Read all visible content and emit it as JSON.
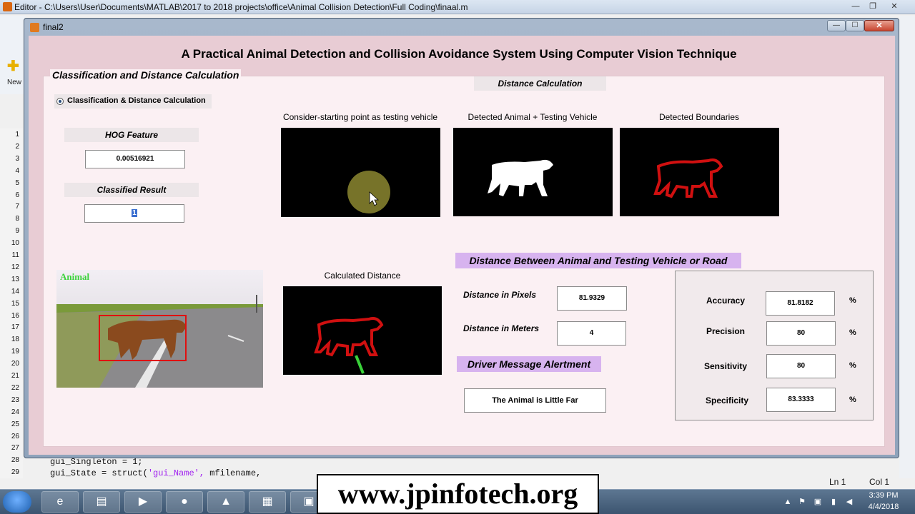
{
  "editor": {
    "title": "Editor - C:\\Users\\User\\Documents\\MATLAB\\2017 to 2018 projects\\office\\Animal Collision Detection\\Full Coding\\finaal.m",
    "new_label": "New",
    "line_numbers": [
      "1",
      "2",
      "3",
      "4",
      "5",
      "6",
      "7",
      "8",
      "9",
      "10",
      "11",
      "12",
      "13",
      "14",
      "15",
      "16",
      "17",
      "18",
      "19",
      "20",
      "21",
      "22",
      "23",
      "24",
      "25",
      "26",
      "27",
      "28",
      "29"
    ],
    "code_line_1": "gui_Singleton = 1;",
    "code_line_2_start": "gui_State = struct(",
    "code_line_2_string": "'gui_Name',",
    "code_line_2_end": "      mfilename,",
    "status_ln": "Ln  1",
    "status_col": "Col  1"
  },
  "taskbar": {
    "time": "3:39 PM",
    "date": "4/4/2018"
  },
  "watermark": "www.jpinfotech.org",
  "figure": {
    "window_title": "final2",
    "main_title": "A Practical Animal Detection and Collision Avoidance System Using Computer Vision Technique",
    "panel_title": "Classification and Distance Calculation",
    "radio_label": "Classification & Distance Calculation",
    "hog_label": "HOG Feature",
    "hog_value": "0.00516921",
    "classified_label": "Classified Result",
    "classified_value": "1",
    "animal_tag": "Animal",
    "distance_calc_header": "Distance Calculation",
    "captions": {
      "starting_point": "Consider-starting point as testing vehicle",
      "detected_animal": "Detected Animal + Testing Vehicle",
      "detected_boundaries": "Detected Boundaries",
      "calculated_distance": "Calculated Distance"
    },
    "distance_between_label": "Distance Between Animal and Testing Vehicle or Road",
    "distance_pixels_label": "Distance in Pixels",
    "distance_pixels_value": "81.9329",
    "distance_meters_label": "Distance in Meters",
    "distance_meters_value": "4",
    "driver_message_label": "Driver Message Alertment",
    "driver_message_value": "The Animal is Little Far",
    "stats": [
      {
        "label": "Accuracy",
        "value": "81.8182",
        "unit": "%"
      },
      {
        "label": "Precision",
        "value": "80",
        "unit": "%"
      },
      {
        "label": "Sensitivity",
        "value": "80",
        "unit": "%"
      },
      {
        "label": "Specificity",
        "value": "83.3333",
        "unit": "%"
      }
    ]
  }
}
